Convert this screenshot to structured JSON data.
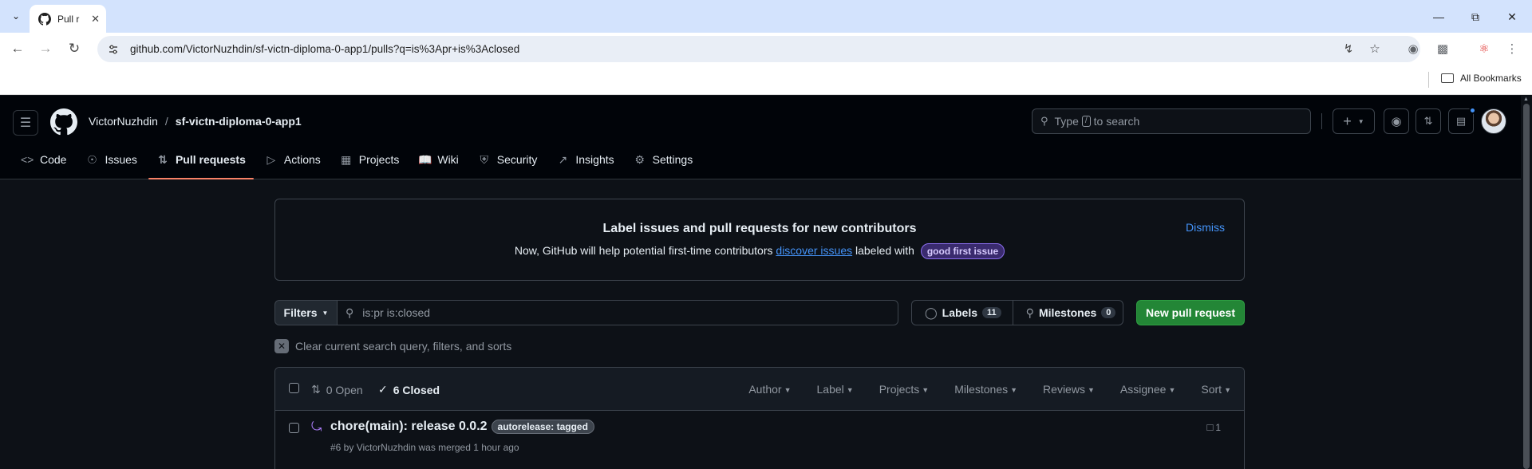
{
  "browser": {
    "tab_title": "Pull r",
    "url": "github.com/VictorNuzhdin/sf-victn-diploma-0-app1/pulls?q=is%3Apr+is%3Aclosed",
    "bookmarks_label": "All Bookmarks"
  },
  "header": {
    "owner": "VictorNuzhdin",
    "separator": "/",
    "repo": "sf-victn-diploma-0-app1",
    "search_pre": "Type",
    "search_key": "/",
    "search_post": "to search"
  },
  "repo_tabs": [
    {
      "label": "Code",
      "icon": "code-icon"
    },
    {
      "label": "Issues",
      "icon": "issue-icon"
    },
    {
      "label": "Pull requests",
      "icon": "pull-request-icon"
    },
    {
      "label": "Actions",
      "icon": "play-icon"
    },
    {
      "label": "Projects",
      "icon": "table-icon"
    },
    {
      "label": "Wiki",
      "icon": "book-icon"
    },
    {
      "label": "Security",
      "icon": "shield-icon"
    },
    {
      "label": "Insights",
      "icon": "graph-icon"
    },
    {
      "label": "Settings",
      "icon": "gear-icon"
    }
  ],
  "banner": {
    "title": "Label issues and pull requests for new contributors",
    "text_pre": "Now, GitHub will help potential first-time contributors",
    "link": "discover issues",
    "text_post": "labeled with",
    "label": "good first issue",
    "dismiss": "Dismiss"
  },
  "filters": {
    "filters_label": "Filters",
    "query": "is:pr is:closed",
    "labels_label": "Labels",
    "labels_count": "11",
    "milestones_label": "Milestones",
    "milestones_count": "0",
    "new_pr_label": "New pull request"
  },
  "clear_text": "Clear current search query, filters, and sorts",
  "list": {
    "open_text": "0 Open",
    "closed_text": "6 Closed",
    "sorts": [
      "Author",
      "Label",
      "Projects",
      "Milestones",
      "Reviews",
      "Assignee",
      "Sort"
    ],
    "items": [
      {
        "title": "chore(main): release 0.0.2",
        "label": "autorelease: tagged",
        "meta": "#6 by VictorNuzhdin was merged 1 hour ago",
        "comments": "1"
      }
    ]
  },
  "colors": {
    "accent_underline": "#f78166",
    "link": "#4493f8",
    "primary_button": "#238636",
    "merged": "#ab7df8"
  }
}
